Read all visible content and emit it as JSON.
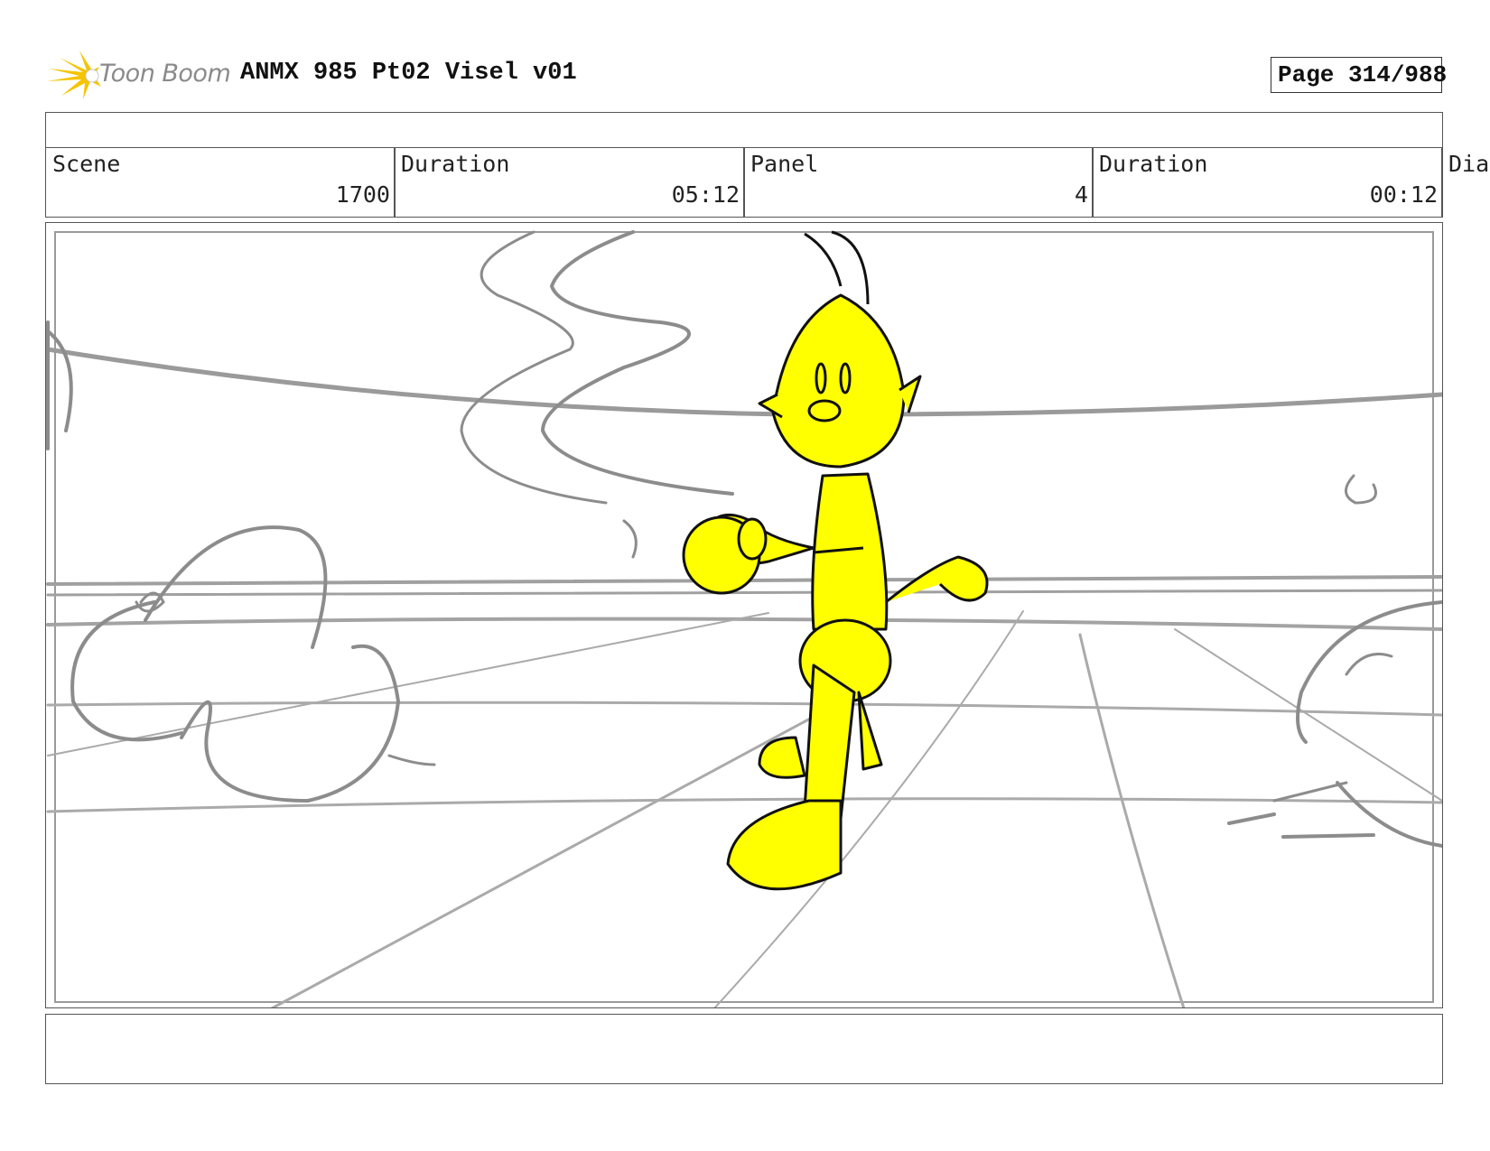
{
  "header": {
    "logo_text": "Toon Boom",
    "title": "ANMX 985 Pt02 Visel v01",
    "page": "Page 314/988"
  },
  "info": {
    "scene_label": "Scene",
    "scene_value": "1700",
    "scene_duration_label": "Duration",
    "scene_duration_value": "05:12",
    "panel_label": "Panel",
    "panel_value": "4",
    "panel_duration_label": "Duration",
    "panel_duration_value": "00:12",
    "dialogue_label": "Dia"
  },
  "colors": {
    "character_fill": "#ffff00",
    "sketch_line": "#8c8c8c",
    "ink": "#111111",
    "logo_burst": "#f5c400"
  }
}
